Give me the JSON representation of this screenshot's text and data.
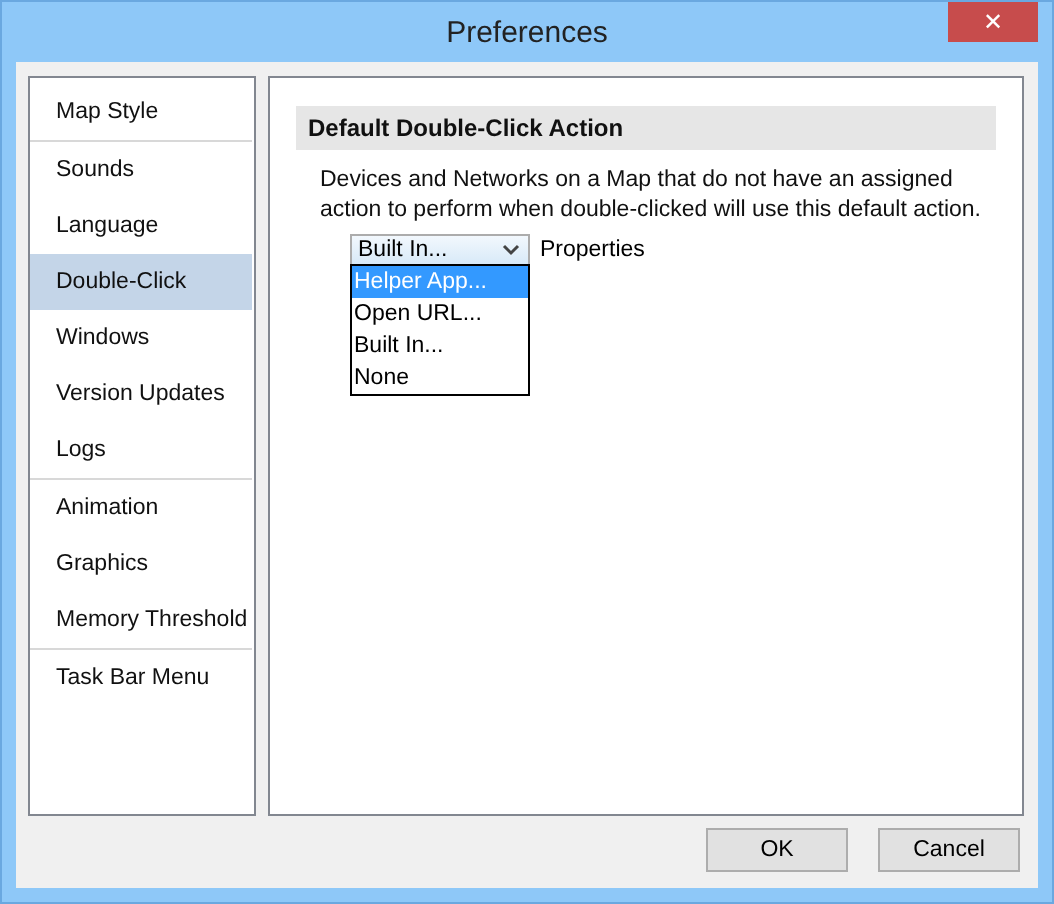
{
  "window": {
    "title": "Preferences",
    "close": "✕"
  },
  "sidebar": {
    "groups": [
      {
        "items": [
          {
            "label": "Map Style",
            "selected": false
          }
        ]
      },
      {
        "items": [
          {
            "label": "Sounds",
            "selected": false
          },
          {
            "label": "Language",
            "selected": false
          },
          {
            "label": "Double-Click",
            "selected": true
          },
          {
            "label": "Windows",
            "selected": false
          },
          {
            "label": "Version Updates",
            "selected": false
          },
          {
            "label": "Logs",
            "selected": false
          }
        ]
      },
      {
        "items": [
          {
            "label": "Animation",
            "selected": false
          },
          {
            "label": "Graphics",
            "selected": false
          },
          {
            "label": "Memory Threshold",
            "selected": false
          }
        ]
      },
      {
        "items": [
          {
            "label": "Task Bar Menu",
            "selected": false
          }
        ]
      }
    ]
  },
  "section": {
    "title": "Default Double-Click Action",
    "description": "Devices and Networks on a Map that do not have an assigned action to perform when double-clicked will use this default action.",
    "dropdown": {
      "value": "Built In...",
      "expanded": true,
      "options": [
        {
          "label": "Helper App...",
          "highlighted": true
        },
        {
          "label": "Open URL...",
          "highlighted": false
        },
        {
          "label": "Built In...",
          "highlighted": false
        },
        {
          "label": "None",
          "highlighted": false
        }
      ]
    },
    "properties": "Properties"
  },
  "buttons": [
    "OK",
    "Cancel"
  ]
}
